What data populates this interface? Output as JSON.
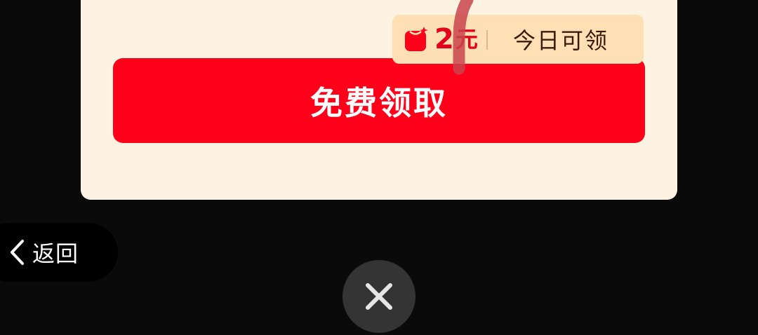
{
  "popup": {
    "claim_button_label": "免费领取",
    "reward_tag": {
      "amount": "2",
      "unit": "元",
      "label": "今日可领",
      "icon": "red-pouch-icon"
    }
  },
  "nav": {
    "back_label": "返回",
    "back_icon": "chevron-left-icon",
    "close_icon": "close-icon"
  },
  "colors": {
    "background": "#0a0a0a",
    "card": "#fef2e2",
    "primary_red": "#fe0019",
    "tag_background": "#fee0b4",
    "amount_red": "#e4001a",
    "close_circle": "#343434"
  }
}
